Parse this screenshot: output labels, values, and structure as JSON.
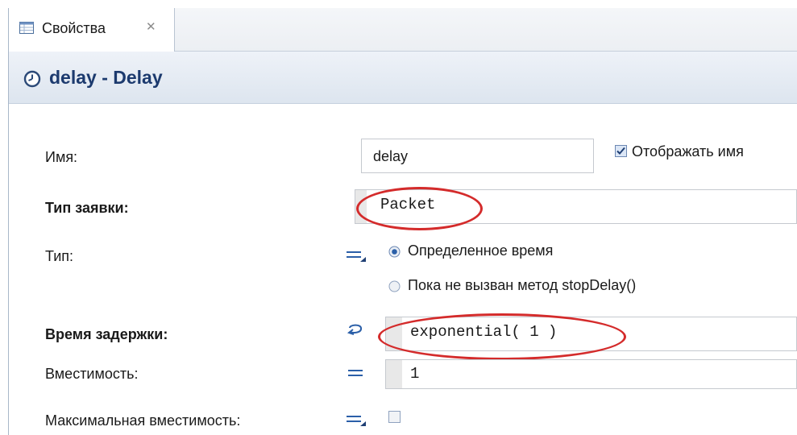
{
  "tab": {
    "label": "Свойства",
    "icon": "properties-table-icon",
    "close_icon": "close-icon"
  },
  "header": {
    "title": "delay - Delay",
    "icon": "clock-icon"
  },
  "form": {
    "name": {
      "label": "Имя:",
      "value": "delay",
      "show_name_label": "Отображать имя",
      "show_name_checked": true
    },
    "agent_type": {
      "label": "Тип заявки:",
      "value": "Packet"
    },
    "type": {
      "label": "Тип:",
      "options": [
        "Определенное время",
        "Пока не вызван метод stopDelay()"
      ],
      "selected": "Определенное время"
    },
    "delay_time": {
      "label": "Время задержки:",
      "value": "exponential( 1 )"
    },
    "capacity": {
      "label": "Вместимость:",
      "value": "1"
    },
    "max_capacity": {
      "label": "Максимальная вместимость:",
      "checked": false
    }
  },
  "colors": {
    "annotation": "#d42b2b",
    "header_title": "#1c3a6e",
    "radio_selected": "#2b5fa8"
  }
}
